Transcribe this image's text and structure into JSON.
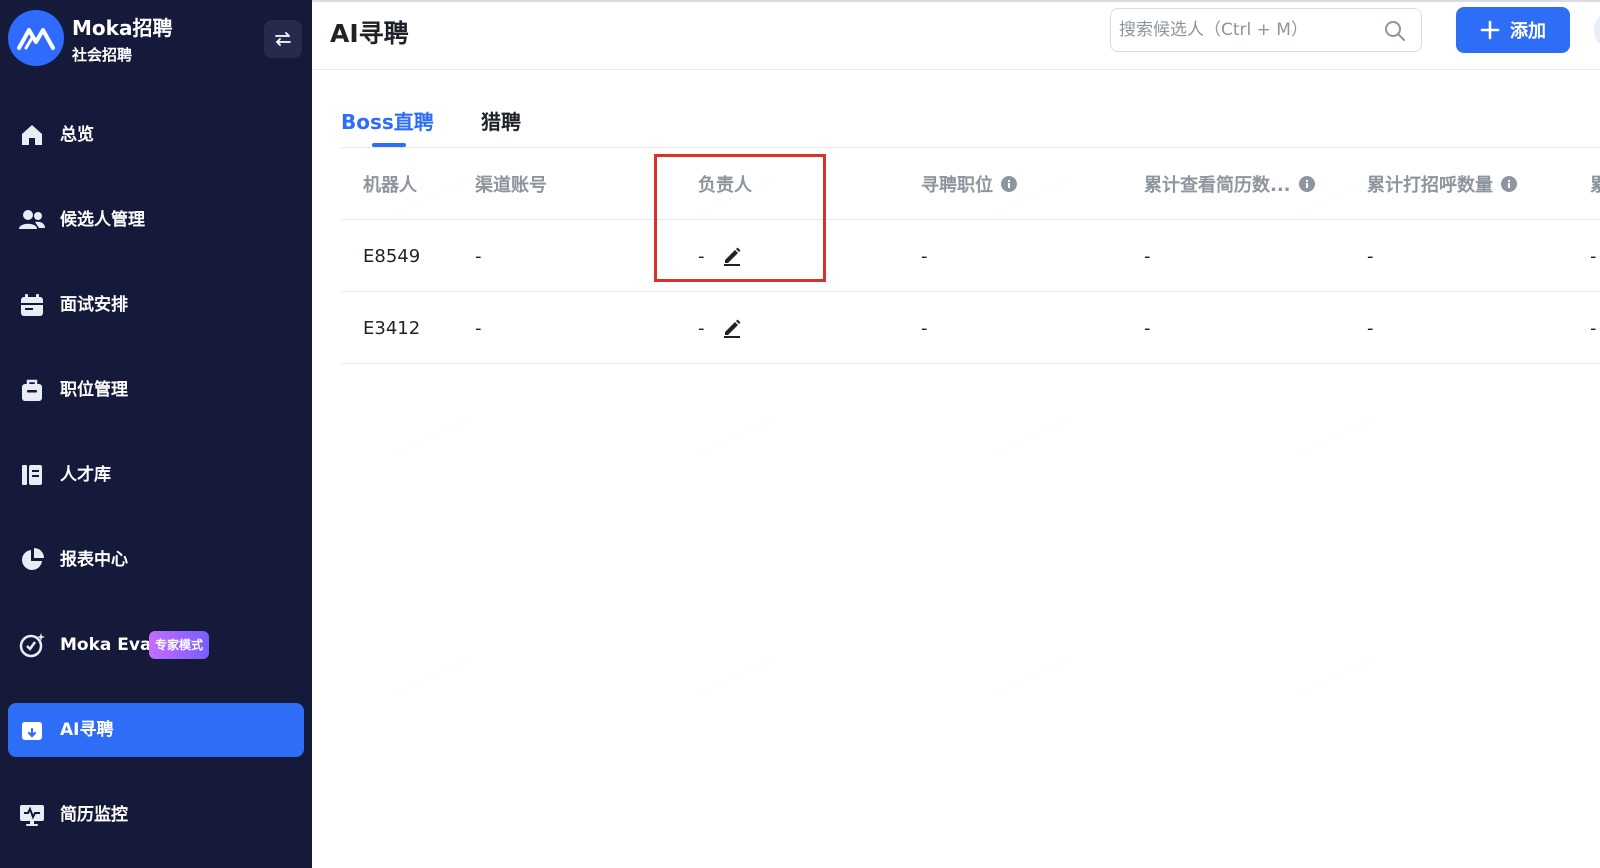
{
  "brand": {
    "name": "Moka招聘",
    "subtitle": "社会招聘"
  },
  "sidebar": {
    "items": [
      {
        "label": "总览",
        "icon": "home-icon"
      },
      {
        "label": "候选人管理",
        "icon": "users-icon"
      },
      {
        "label": "面试安排",
        "icon": "calendar-icon"
      },
      {
        "label": "职位管理",
        "icon": "briefcase-icon"
      },
      {
        "label": "人才库",
        "icon": "books-icon"
      },
      {
        "label": "报表中心",
        "icon": "pie-chart-icon"
      },
      {
        "label": "Moka Eva",
        "icon": "eva-icon",
        "badge": "专家模式"
      },
      {
        "label": "AI寻聘",
        "icon": "ai-box-icon",
        "active": true
      },
      {
        "label": "简历监控",
        "icon": "monitor-icon"
      }
    ]
  },
  "header": {
    "title": "AI寻聘",
    "search_placeholder": "搜索候选人（Ctrl + M）",
    "add_label": "添加"
  },
  "tabs": [
    {
      "label": "Boss直聘",
      "active": true
    },
    {
      "label": "猎聘",
      "active": false
    }
  ],
  "table": {
    "columns": [
      "机器人",
      "渠道账号",
      "负责人",
      "寻聘职位",
      "累计查看简历数...",
      "累计打招呼数量",
      "累"
    ],
    "rows": [
      {
        "robot": "E8549",
        "channel": "-",
        "owner": "-",
        "position": "-",
        "viewed": "-",
        "greeted": "-",
        "extra": "-"
      },
      {
        "robot": "E3412",
        "channel": "-",
        "owner": "-",
        "position": "-",
        "viewed": "-",
        "greeted": "-",
        "extra": "-"
      }
    ]
  },
  "colors": {
    "sidebar_bg": "#151a3b",
    "accent": "#2e6df5",
    "highlight": "#d9322b",
    "badge_gradient": "#c46cff"
  }
}
